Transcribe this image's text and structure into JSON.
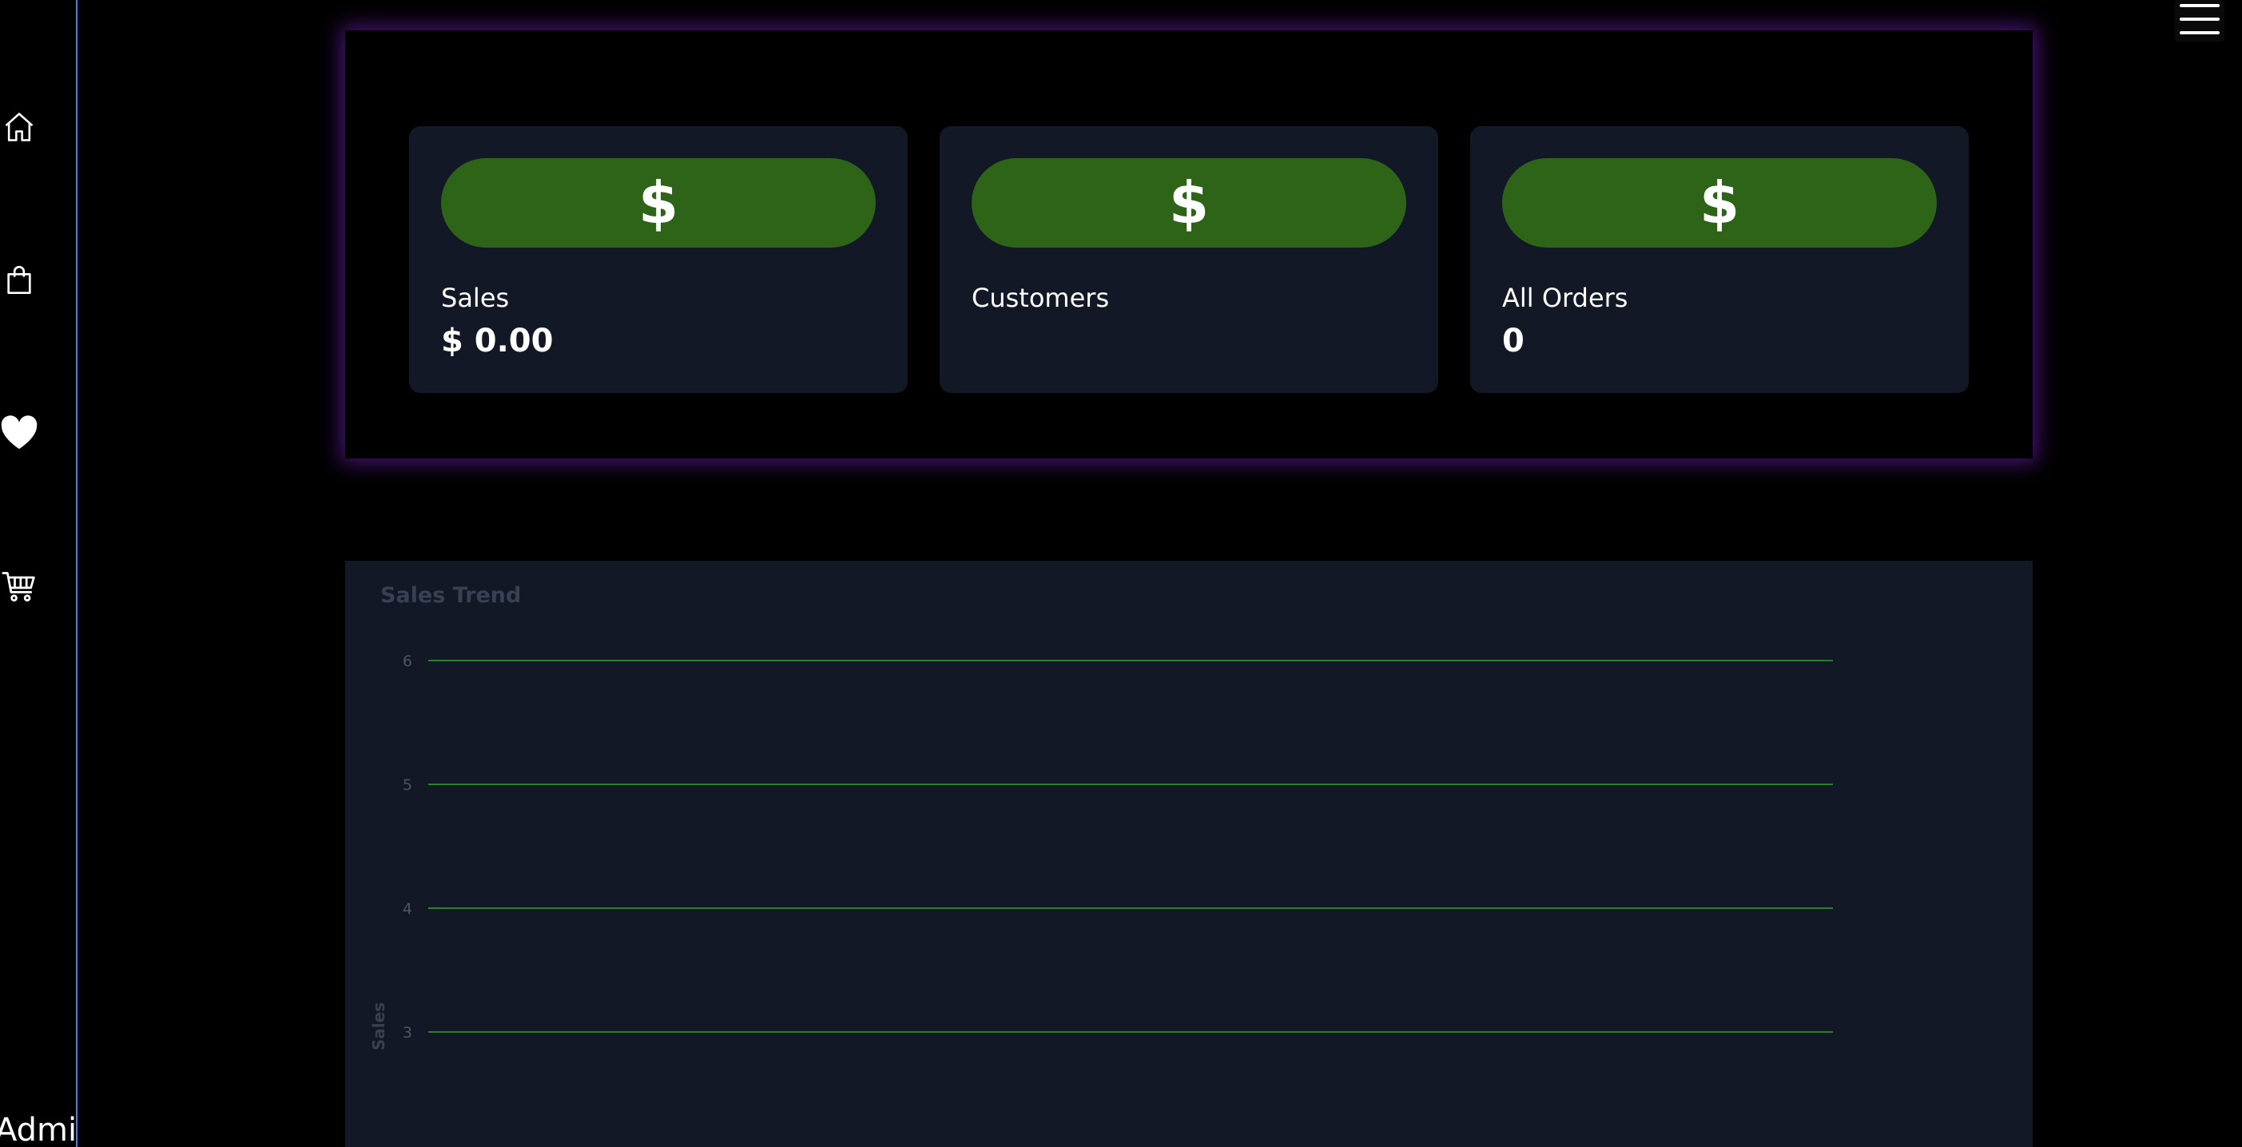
{
  "sidebar": {
    "items": [
      {
        "icon": "home-icon"
      },
      {
        "icon": "shopping-bag-icon"
      },
      {
        "icon": "heart-icon"
      },
      {
        "icon": "cart-icon"
      }
    ],
    "footer_label": "Admin"
  },
  "header": {
    "menu_icon": "hamburger-menu-icon"
  },
  "stats": {
    "cards": [
      {
        "icon_text": "$",
        "label": "Sales",
        "value": "$ 0.00"
      },
      {
        "icon_text": "$",
        "label": "Customers",
        "value": ""
      },
      {
        "icon_text": "$",
        "label": "All Orders",
        "value": "0"
      }
    ]
  },
  "colors": {
    "accent_green": "#2d6418",
    "panel_glow": "#7e22ce",
    "sidebar_border": "#3b82f6",
    "card_bg": "#121826",
    "gridline": "#2f7d32"
  },
  "chart_data": {
    "type": "line",
    "title": "Sales Trend",
    "xlabel": "",
    "ylabel": "Sales",
    "y_ticks": [
      6,
      5,
      4,
      3
    ],
    "grid": true,
    "series": []
  }
}
